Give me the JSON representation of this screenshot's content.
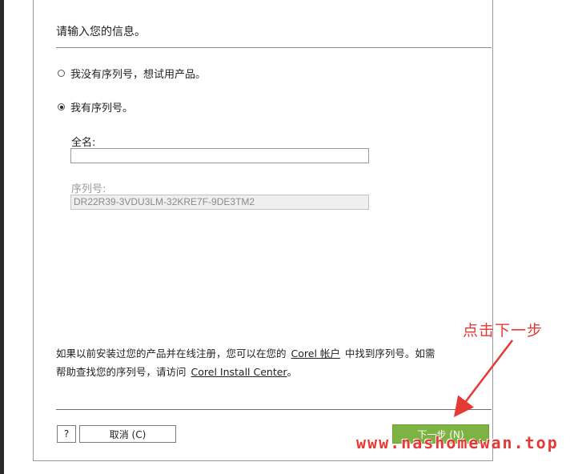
{
  "header": {
    "title": "请输入您的信息。"
  },
  "options": [
    {
      "label": "我没有序列号，想试用产品。",
      "checked": false
    },
    {
      "label": "我有序列号。",
      "checked": true
    }
  ],
  "form": {
    "fullname_label": "全名:",
    "fullname_value": "",
    "serial_label": "序列号:",
    "serial_value": "DR22R39-3VDU3LM-32KRE7F-9DE3TM2"
  },
  "info": {
    "line1_pre": "如果以前安装过您的产品并在线注册，您可以在您的",
    "link_account": "Corel 帐户",
    "line1_post": "中找到序列号。如需",
    "line2_pre": "帮助查找您的序列号，请访问",
    "link_install": "Corel Install Center",
    "line2_post": "。"
  },
  "buttons": {
    "help": "?",
    "cancel": "取消 (C)",
    "next": "下一步 (N)"
  },
  "annotation": {
    "hint": "点击下一步",
    "watermark": "www.nashomewan.top",
    "color": "#e53935"
  },
  "colors": {
    "next_button": "#7cb342"
  }
}
